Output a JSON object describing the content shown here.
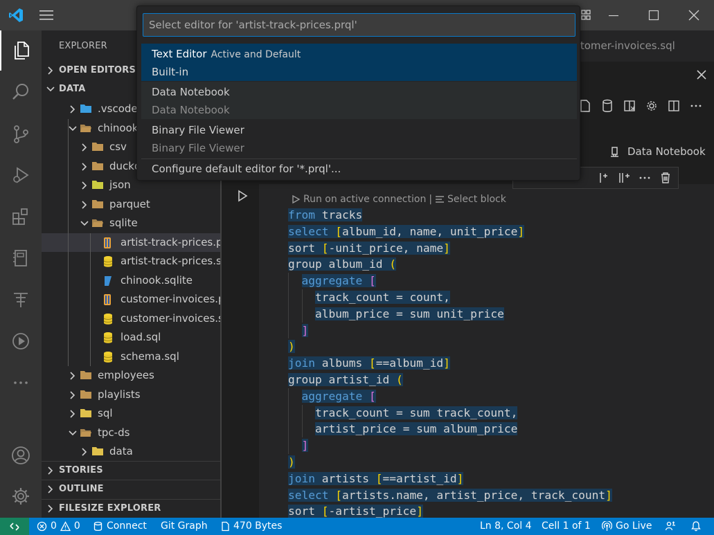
{
  "colors": {
    "titlebar": "#3c3c3c",
    "activitybar": "#333333",
    "sidebar": "#252526",
    "editor": "#1e1e1e",
    "statusbar": "#007acc",
    "remote": "#16825d",
    "accent": "#0a7ac9",
    "quickpick_selected": "#04395e",
    "keyword": "#569cd6",
    "bracket_gold": "#ffd700",
    "bracket_purple": "#da70d6"
  },
  "titlebar": {
    "icons": [
      "vscode-logo-icon",
      "hamburger-menu-icon",
      "layout-icon",
      "minimize-icon",
      "maximize-icon",
      "close-icon"
    ]
  },
  "activitybar": {
    "items": [
      "explorer-icon",
      "search-icon",
      "source-control-icon",
      "run-debug-icon",
      "extensions-icon",
      "notebook-icon",
      "filesize-icon",
      "play-icon",
      "more-icon"
    ],
    "bottom": [
      "account-icon",
      "settings-gear-icon"
    ]
  },
  "sidebar": {
    "title": "EXPLORER",
    "open_editors": "OPEN EDITORS",
    "data_section": "DATA",
    "tree": [
      {
        "label": ".vscode",
        "type": "folder",
        "icon_color": "#3b9fe0",
        "level": 1,
        "expanded": false
      },
      {
        "label": "chinook",
        "type": "folder",
        "icon_color": "#c09553",
        "level": 1,
        "expanded": true
      },
      {
        "label": "csv",
        "type": "folder",
        "icon_color": "#c09553",
        "level": 2,
        "expanded": false
      },
      {
        "label": "duckdb",
        "type": "folder",
        "icon_color": "#c09553",
        "level": 2,
        "expanded": false
      },
      {
        "label": "json",
        "type": "folder",
        "icon_color": "#cbcb41",
        "level": 2,
        "expanded": false
      },
      {
        "label": "parquet",
        "type": "folder",
        "icon_color": "#c09553",
        "level": 2,
        "expanded": false
      },
      {
        "label": "sqlite",
        "type": "folder",
        "icon_color": "#c09553",
        "level": 2,
        "expanded": true
      },
      {
        "label": "artist-track-prices.prql",
        "type": "prql",
        "level": 3,
        "selected": true
      },
      {
        "label": "artist-track-prices.sql",
        "type": "sql",
        "level": 3
      },
      {
        "label": "chinook.sqlite",
        "type": "sqlite",
        "level": 3
      },
      {
        "label": "customer-invoices.prql",
        "type": "prql",
        "level": 3
      },
      {
        "label": "customer-invoices.sql",
        "type": "sql",
        "level": 3
      },
      {
        "label": "load.sql",
        "type": "sql",
        "level": 3
      },
      {
        "label": "schema.sql",
        "type": "sql",
        "level": 3
      },
      {
        "label": "employees",
        "type": "folder",
        "icon_color": "#c09553",
        "level": 1,
        "expanded": false
      },
      {
        "label": "playlists",
        "type": "folder",
        "icon_color": "#c09553",
        "level": 1,
        "expanded": false
      },
      {
        "label": "sql",
        "type": "folder",
        "icon_color": "#e0c14c",
        "level": 1,
        "expanded": false
      },
      {
        "label": "tpc-ds",
        "type": "folder",
        "icon_color": "#c09553",
        "level": 1,
        "expanded": true
      },
      {
        "label": "data",
        "type": "folder",
        "icon_color": "#e0c14c",
        "level": 2,
        "expanded": false
      }
    ],
    "stories": "STORIES",
    "outline": "OUTLINE",
    "filesize_explorer": "FILESIZE EXPLORER"
  },
  "editor": {
    "tab_label": "stomer-invoices.sql",
    "notebook_label": "Data Notebook",
    "codelens_run": "Run on active connection",
    "codelens_sep": "|",
    "codelens_select": "Select block",
    "code_lines": [
      {
        "indent": 0,
        "tokens": [
          [
            "kw",
            "from"
          ],
          [
            "",
            " tracks"
          ]
        ]
      },
      {
        "indent": 0,
        "tokens": [
          [
            "kw",
            "select"
          ],
          [
            "",
            " "
          ],
          [
            "br1",
            "["
          ],
          [
            "",
            "album_id, name, unit_price"
          ],
          [
            "br1",
            "]"
          ]
        ]
      },
      {
        "indent": 0,
        "tokens": [
          [
            "",
            "sort "
          ],
          [
            "br1",
            "["
          ],
          [
            "",
            "-unit_price, name"
          ],
          [
            "br1",
            "]"
          ]
        ]
      },
      {
        "indent": 0,
        "tokens": [
          [
            "",
            "group album_id "
          ],
          [
            "br1",
            "("
          ]
        ]
      },
      {
        "indent": 1,
        "tokens": [
          [
            "kw",
            "aggregate"
          ],
          [
            "",
            " "
          ],
          [
            "br2",
            "["
          ]
        ]
      },
      {
        "indent": 2,
        "tokens": [
          [
            "",
            "track_count = count,"
          ]
        ]
      },
      {
        "indent": 2,
        "tokens": [
          [
            "",
            "album_price = sum unit_price"
          ]
        ]
      },
      {
        "indent": 1,
        "tokens": [
          [
            "br2",
            "]"
          ]
        ]
      },
      {
        "indent": 0,
        "tokens": [
          [
            "br1",
            ")"
          ]
        ]
      },
      {
        "indent": 0,
        "tokens": [
          [
            "kw",
            "join"
          ],
          [
            "",
            " albums "
          ],
          [
            "br1",
            "["
          ],
          [
            "",
            "==album_id"
          ],
          [
            "br1",
            "]"
          ]
        ]
      },
      {
        "indent": 0,
        "tokens": [
          [
            "",
            "group artist_id "
          ],
          [
            "br1",
            "("
          ]
        ]
      },
      {
        "indent": 1,
        "tokens": [
          [
            "kw",
            "aggregate"
          ],
          [
            "",
            " "
          ],
          [
            "br2",
            "["
          ]
        ]
      },
      {
        "indent": 2,
        "tokens": [
          [
            "",
            "track_count = sum track_count,"
          ]
        ]
      },
      {
        "indent": 2,
        "tokens": [
          [
            "",
            "artist_price = sum album_price"
          ]
        ]
      },
      {
        "indent": 1,
        "tokens": [
          [
            "br2",
            "]"
          ]
        ]
      },
      {
        "indent": 0,
        "tokens": [
          [
            "br1",
            ")"
          ]
        ]
      },
      {
        "indent": 0,
        "tokens": [
          [
            "kw",
            "join"
          ],
          [
            "",
            " artists "
          ],
          [
            "br1",
            "["
          ],
          [
            "",
            "==artist_id"
          ],
          [
            "br1",
            "]"
          ]
        ]
      },
      {
        "indent": 0,
        "tokens": [
          [
            "kw",
            "select"
          ],
          [
            "",
            " "
          ],
          [
            "br1",
            "["
          ],
          [
            "",
            "artists.name, artist_price, track_count"
          ],
          [
            "br1",
            "]"
          ]
        ]
      },
      {
        "indent": 0,
        "tokens": [
          [
            "",
            "sort "
          ],
          [
            "br1",
            "["
          ],
          [
            "",
            "-artist_price"
          ],
          [
            "br1",
            "]"
          ]
        ]
      }
    ]
  },
  "quickpick": {
    "placeholder": "Select editor for 'artist-track-prices.prql'",
    "value": "",
    "items": [
      {
        "title": "Text Editor",
        "description": "Active and Default",
        "source": "Built-in",
        "state": "selected"
      },
      {
        "title": "Data Notebook",
        "description": "",
        "source": "Data Notebook",
        "state": "hover"
      },
      {
        "title": "Binary File Viewer",
        "description": "",
        "source": "Binary File Viewer",
        "state": ""
      }
    ],
    "configure": "Configure default editor for '*.prql'..."
  },
  "statusbar": {
    "problems_errors": "0",
    "problems_warnings": "0",
    "connect": "Connect",
    "git_graph": "Git Graph",
    "filesize": "470 Bytes",
    "position": "Ln 8, Col 4",
    "cell": "Cell 1 of 1",
    "go_live": "Go Live"
  }
}
